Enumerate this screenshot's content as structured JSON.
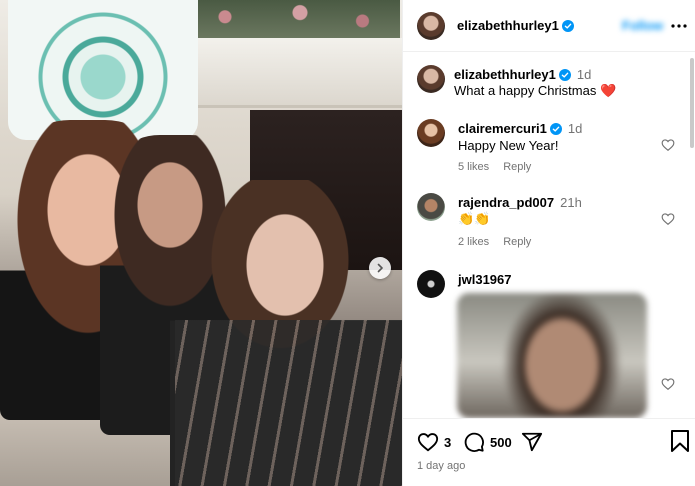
{
  "header": {
    "username": "elizabethhurley1",
    "follow_label": "Follow"
  },
  "comments": [
    {
      "username": "elizabethhurley1",
      "time": "1d",
      "text": "What a happy Christmas ❤️",
      "verified": true
    },
    {
      "username": "clairemercuri1",
      "time": "1d",
      "text": "Happy New Year!",
      "likes": "5 likes",
      "reply": "Reply",
      "verified": true
    },
    {
      "username": "rajendra_pd007",
      "time": "21h",
      "text": "👏👏",
      "likes": "2 likes",
      "reply": "Reply"
    },
    {
      "username": "jwl31967"
    }
  ],
  "footer": {
    "likes": "3",
    "comments": "500",
    "posted": "1 day ago"
  },
  "colors": {
    "accent": "#0095f6",
    "heart_emoji": "#a0272d",
    "muted": "#737373"
  },
  "icons": [
    "verified-icon",
    "more-icon",
    "heart-icon",
    "comment-icon",
    "share-icon",
    "bookmark-icon",
    "chevron-right-icon"
  ]
}
